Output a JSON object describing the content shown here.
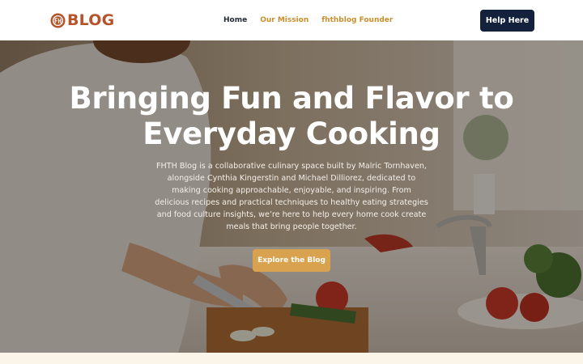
{
  "brand": {
    "logo_text": "BLOG",
    "logo_icon": "fh-roundel-icon",
    "color": "#b5542a"
  },
  "nav": {
    "items": [
      {
        "label": "Home",
        "active": true
      },
      {
        "label": "Our Mission",
        "active": false
      },
      {
        "label": "fhthblog Founder",
        "active": false
      }
    ],
    "active_color": "#222a33",
    "accent_color": "#c98f2e"
  },
  "header": {
    "cta_label": "Help Here",
    "cta_color": "#14213d"
  },
  "hero": {
    "title": "Bringing Fun and Flavor to Everyday Cooking",
    "description": "FHTH Blog is a collaborative culinary space built by Malric Tornhaven, alongside Cynthia Kingerstin and Michael Dilliorez, dedicated to making cooking approachable, enjoyable, and inspiring. From delicious recipes and practical techniques to healthy eating strategies and food culture insights, we’re here to help every home cook create meals that bring people together.",
    "cta_label": "Explore the Blog",
    "cta_color": "#d9a24e",
    "background_subject": "woman-slicing-vegetables-in-kitchen"
  }
}
